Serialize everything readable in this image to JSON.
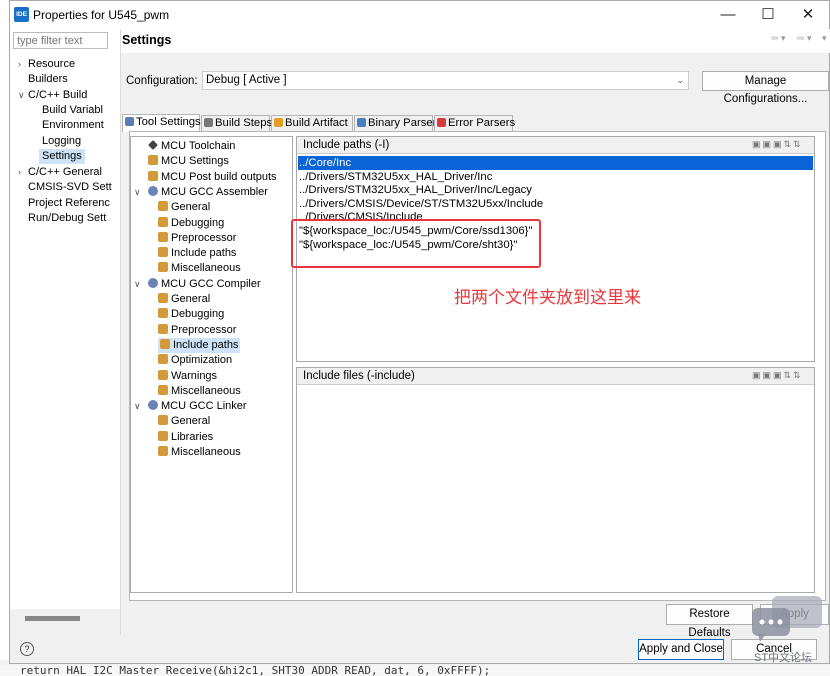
{
  "window": {
    "title": "Properties for U545_pwm",
    "logo_text": "IDE"
  },
  "filter_placeholder": "type filter text",
  "nav": [
    {
      "label": "Resource",
      "toggle": "›"
    },
    {
      "label": "Builders",
      "toggle": ""
    },
    {
      "label": "C/C++ Build",
      "toggle": "v"
    },
    {
      "label": "Build Variabl",
      "toggle": ""
    },
    {
      "label": "Environment",
      "toggle": ""
    },
    {
      "label": "Logging",
      "toggle": ""
    },
    {
      "label": "Settings",
      "toggle": ""
    },
    {
      "label": "C/C++ General",
      "toggle": "›"
    },
    {
      "label": "CMSIS-SVD Sett",
      "toggle": ""
    },
    {
      "label": "Project Referenc",
      "toggle": ""
    },
    {
      "label": "Run/Debug Sett",
      "toggle": ""
    }
  ],
  "settings_title": "Settings",
  "configuration": {
    "label": "Configuration:",
    "value": "Debug  [ Active ]",
    "manage_button": "Manage Configurations..."
  },
  "tabs": [
    {
      "label": "Tool Settings",
      "icon": "gear-icon",
      "color": "#5b7bb5"
    },
    {
      "label": "Build Steps",
      "icon": "wrench-icon",
      "color": "#777777"
    },
    {
      "label": "Build Artifact",
      "icon": "artifact-icon",
      "color": "#e0a020"
    },
    {
      "label": "Binary Parsers",
      "icon": "parser-icon",
      "color": "#4a7fbf"
    },
    {
      "label": "Error Parsers",
      "icon": "error-icon",
      "color": "#d83b3b"
    }
  ],
  "tool_tree": [
    {
      "label": "MCU Toolchain",
      "icon": "tool"
    },
    {
      "label": "MCU Settings",
      "icon": "pen"
    },
    {
      "label": "MCU Post build outputs",
      "icon": "pen"
    },
    {
      "label": "MCU GCC Assembler",
      "icon": "gear",
      "toggle": "v"
    },
    {
      "label": "General",
      "icon": "pen"
    },
    {
      "label": "Debugging",
      "icon": "pen"
    },
    {
      "label": "Preprocessor",
      "icon": "pen"
    },
    {
      "label": "Include paths",
      "icon": "pen"
    },
    {
      "label": "Miscellaneous",
      "icon": "pen"
    },
    {
      "label": "MCU GCC Compiler",
      "icon": "gear",
      "toggle": "v"
    },
    {
      "label": "General",
      "icon": "pen"
    },
    {
      "label": "Debugging",
      "icon": "pen"
    },
    {
      "label": "Preprocessor",
      "icon": "pen"
    },
    {
      "label": "Include paths",
      "icon": "pen",
      "selected": true
    },
    {
      "label": "Optimization",
      "icon": "pen"
    },
    {
      "label": "Warnings",
      "icon": "pen"
    },
    {
      "label": "Miscellaneous",
      "icon": "pen"
    },
    {
      "label": "MCU GCC Linker",
      "icon": "gear",
      "toggle": "v"
    },
    {
      "label": "General",
      "icon": "pen"
    },
    {
      "label": "Libraries",
      "icon": "pen"
    },
    {
      "label": "Miscellaneous",
      "icon": "pen"
    }
  ],
  "include_paths": {
    "title": "Include paths (-I)",
    "items": [
      "../Core/Inc",
      "../Drivers/STM32U5xx_HAL_Driver/Inc",
      "../Drivers/STM32U5xx_HAL_Driver/Inc/Legacy",
      "../Drivers/CMSIS/Device/ST/STM32U5xx/Include",
      "../Drivers/CMSIS/Include",
      "\"${workspace_loc:/U545_pwm/Core/ssd1306}\"",
      "\"${workspace_loc:/U545_pwm/Core/sht30}\""
    ],
    "selected_index": 0
  },
  "include_files": {
    "title": "Include files (-include)",
    "items": []
  },
  "annotation": "把两个文件夹放到这里来",
  "buttons": {
    "restore": "Restore Defaults",
    "apply": "Apply",
    "apply_close": "Apply and Close",
    "cancel": "Cancel"
  },
  "watermark": "ST中文论坛",
  "background_code": "return HAL_I2C_Master_Receive(&hi2c1, SHT30_ADDR_READ, dat, 6, 0xFFFF);",
  "colors": {
    "selection": "#0a64d8",
    "annotation_red": "#e8363d",
    "tree_selected": "#cfe3f6"
  }
}
